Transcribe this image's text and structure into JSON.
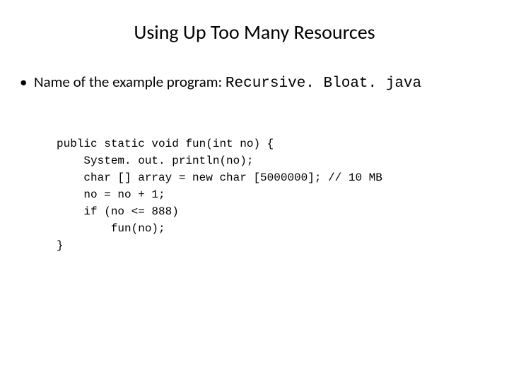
{
  "title": "Using Up Too Many Resources",
  "bullet": {
    "prefix": "Name of the example program: ",
    "filename": "Recursive. Bloat. java"
  },
  "code": {
    "l1": "public static void fun(int no) {",
    "l2": "    System. out. println(no);",
    "l3": "    char [] array = new char [5000000]; // 10 MB",
    "l4": "    no = no + 1;",
    "l5": "    if (no <= 888)",
    "l6": "        fun(no);",
    "l7": "}"
  }
}
